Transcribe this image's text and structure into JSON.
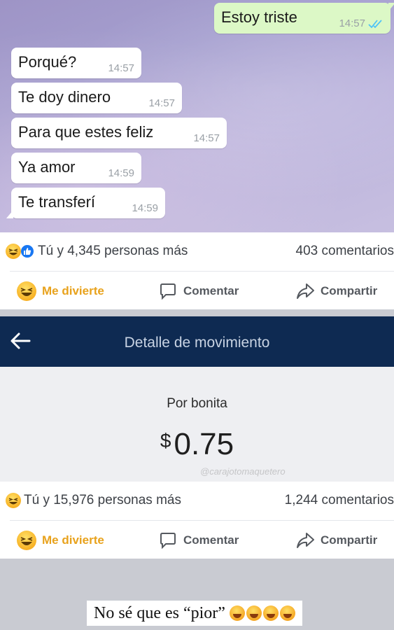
{
  "chat": {
    "messages": [
      {
        "text": "Estoy triste",
        "time": "14:57",
        "direction": "outgoing",
        "status": "read"
      },
      {
        "text": "Porqué?",
        "time": "14:57",
        "direction": "incoming"
      },
      {
        "text": "Te doy dinero",
        "time": "14:57",
        "direction": "incoming"
      },
      {
        "text": "Para que estes feliz",
        "time": "14:57",
        "direction": "incoming"
      },
      {
        "text": "Ya amor",
        "time": "14:59",
        "direction": "incoming"
      },
      {
        "text": "Te transferí",
        "time": "14:59",
        "direction": "incoming"
      }
    ]
  },
  "post1": {
    "reactions_text": "Tú y 4,345 personas más",
    "comments_text": "403 comentarios",
    "reaction_icons": [
      "haha-icon",
      "like-icon"
    ]
  },
  "post2": {
    "reactions_text": "Tú y 15,976 personas más",
    "comments_text": "1,244 comentarios",
    "reaction_icons": [
      "haha-icon"
    ]
  },
  "actions": {
    "haha_label": "Me divierte",
    "comment_label": "Comentar",
    "share_label": "Compartir"
  },
  "bank": {
    "title": "Detalle de movimiento",
    "concept": "Por bonita",
    "currency": "$",
    "amount": "0.75",
    "watermark": "@carajotomaquetero"
  },
  "caption": {
    "text": "No sé que es “pior”",
    "emoji_count": 4
  },
  "colors": {
    "outgoing_bubble": "#dcf8c6",
    "incoming_bubble": "#ffffff",
    "haha_accent": "#e8a21c",
    "bank_header": "#0e2a52",
    "read_ticks": "#4fc3f7"
  }
}
